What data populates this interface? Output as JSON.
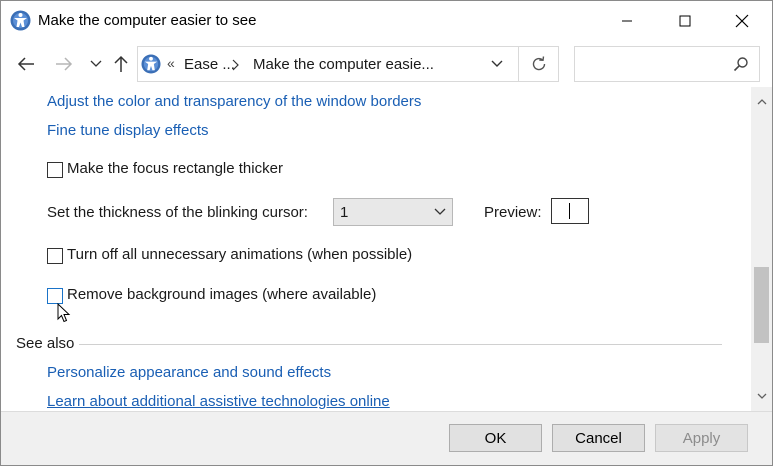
{
  "window": {
    "title": "Make the computer easier to see",
    "icon": "control-panel-icon"
  },
  "navbar": {
    "breadcrumb_separator": "«",
    "crumbs": [
      "Ease ...",
      "Make the computer easie..."
    ],
    "search_placeholder": ""
  },
  "content": {
    "link_window_borders": "Adjust the color and transparency of the window borders",
    "link_display_effects": "Fine tune display effects",
    "focus_rectangle_label": "Make the focus rectangle thicker",
    "focus_rectangle_checked": false,
    "cursor_thickness_label": "Set the thickness of the blinking cursor:",
    "cursor_thickness_value": "1",
    "preview_label": "Preview:",
    "animations_label": "Turn off all unnecessary animations (when possible)",
    "animations_checked": false,
    "background_images_label": "Remove background images (where available)",
    "background_images_checked": false,
    "see_also_heading": "See also",
    "link_personalize": "Personalize appearance and sound effects",
    "link_assistive": "Learn about additional assistive technologies online"
  },
  "footer": {
    "ok_label": "OK",
    "cancel_label": "Cancel",
    "apply_label": "Apply"
  },
  "colors": {
    "link": "#1a5fb4",
    "focus_border": "#1a73c8"
  }
}
